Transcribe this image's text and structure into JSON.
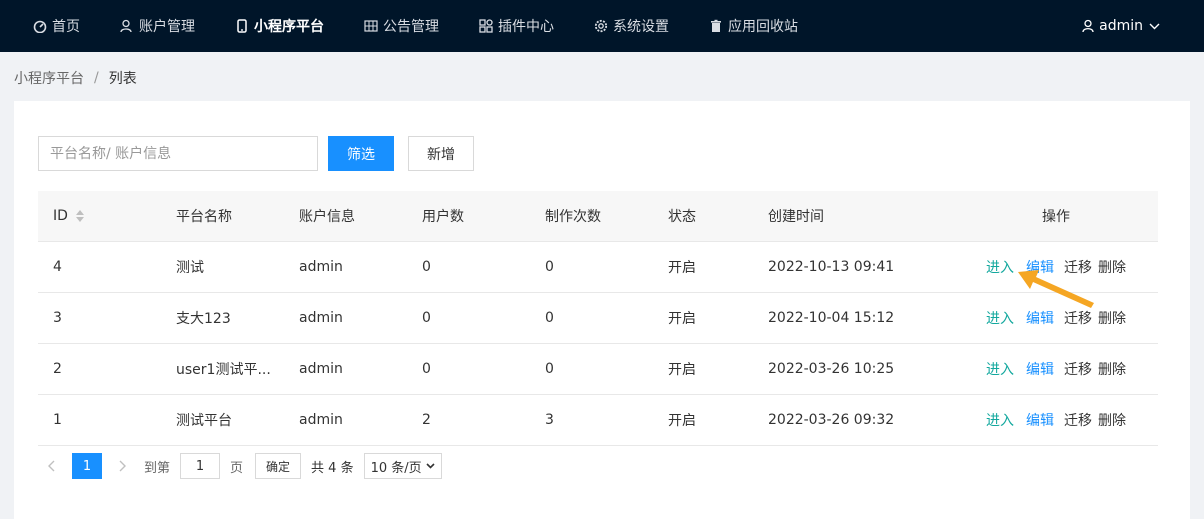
{
  "nav": {
    "items": [
      {
        "label": "首页",
        "icon": "dashboard-icon"
      },
      {
        "label": "账户管理",
        "icon": "users-icon"
      },
      {
        "label": "小程序平台",
        "icon": "mobile-icon",
        "active": true
      },
      {
        "label": "公告管理",
        "icon": "grid-icon"
      },
      {
        "label": "插件中心",
        "icon": "apps-icon"
      },
      {
        "label": "系统设置",
        "icon": "gear-icon"
      },
      {
        "label": "应用回收站",
        "icon": "trash-icon"
      }
    ],
    "user": "admin"
  },
  "breadcrumb": {
    "parent": "小程序平台",
    "separator": "/",
    "current": "列表"
  },
  "filter": {
    "placeholder": "平台名称/ 账户信息",
    "value": "",
    "filter_label": "筛选",
    "add_label": "新增"
  },
  "table": {
    "columns": {
      "id": "ID",
      "name": "平台名称",
      "account": "账户信息",
      "users": "用户数",
      "make": "制作次数",
      "status": "状态",
      "created": "创建时间",
      "ops": "操作"
    },
    "rows": [
      {
        "id": "4",
        "name": "测试",
        "account": "admin",
        "users": "0",
        "make": "0",
        "status": "开启",
        "created": "2022-10-13 09:41"
      },
      {
        "id": "3",
        "name": "支大123",
        "account": "admin",
        "users": "0",
        "make": "0",
        "status": "开启",
        "created": "2022-10-04 15:12"
      },
      {
        "id": "2",
        "name": "user1测试平...",
        "account": "admin",
        "users": "0",
        "make": "0",
        "status": "开启",
        "created": "2022-03-26 10:25"
      },
      {
        "id": "1",
        "name": "测试平台",
        "account": "admin",
        "users": "2",
        "make": "3",
        "status": "开启",
        "created": "2022-03-26 09:32"
      }
    ],
    "actions": {
      "enter": "进入",
      "edit": "编辑",
      "move": "迁移",
      "delete": "删除"
    }
  },
  "pagination": {
    "current_page": "1",
    "goto_prefix": "到第",
    "goto_value": "1",
    "goto_suffix": "页",
    "confirm": "确定",
    "total": "共 4 条",
    "page_size": "10 条/页"
  },
  "colors": {
    "nav_bg": "#001529",
    "primary": "#1890ff",
    "enter_link": "#13a89e",
    "annotation_arrow": "#f5a623"
  }
}
